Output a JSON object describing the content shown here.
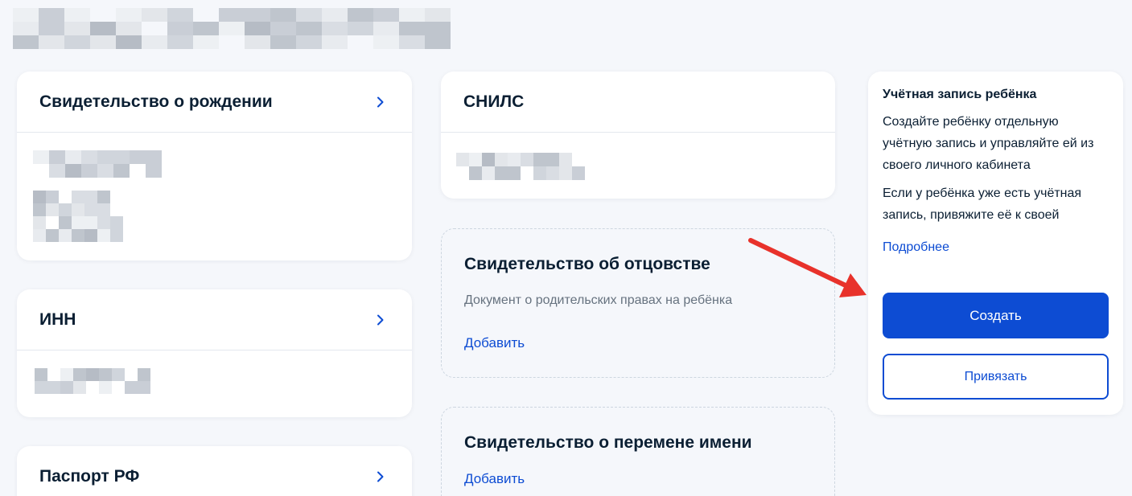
{
  "cards": {
    "birth_certificate": {
      "title": "Свидетельство о рождении"
    },
    "inn": {
      "title": "ИНН"
    },
    "passport": {
      "title": "Паспорт РФ"
    },
    "snils": {
      "title": "СНИЛС"
    },
    "paternity": {
      "title": "Свидетельство об отцовстве",
      "description": "Документ о родительских правах на ребёнка",
      "add_label": "Добавить"
    },
    "name_change": {
      "title": "Свидетельство о перемене имени",
      "add_label": "Добавить"
    }
  },
  "child_account": {
    "title": "Учётная запись ребёнка",
    "text_create": "Создайте ребёнку отдельную учётную запись и управляйте ей из своего личного кабинета",
    "text_link": "Если у ребёнка уже есть учётная запись, привяжите её к своей",
    "more_label": "Подробнее",
    "create_label": "Создать",
    "link_label": "Привязать"
  },
  "icons": {
    "chevron": "chevron-right-icon",
    "arrow": "annotation-arrow"
  },
  "colors": {
    "accent": "#0d4cd3",
    "annotation": "#e8322b",
    "background": "#f5f7fb",
    "muted_text": "#66727f"
  }
}
